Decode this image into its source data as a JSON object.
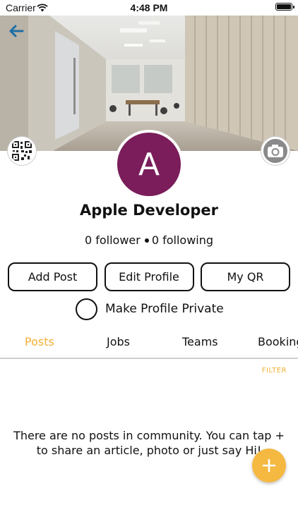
{
  "status_bar": {
    "carrier": "Carrier",
    "time": "4:48 PM"
  },
  "header": {
    "back_icon": "arrow-left-icon",
    "cover_image": "office-hallway-photo"
  },
  "profile": {
    "avatar_initial": "A",
    "avatar_color": "#7a1d5a",
    "name": "Apple Developer",
    "followers": "0 follower",
    "following": "0 following"
  },
  "actions": {
    "add_post": "Add Post",
    "edit_profile": "Edit Profile",
    "my_qr": "My QR"
  },
  "privacy": {
    "label": "Make Profile Private",
    "checked": false
  },
  "tabs": [
    {
      "label": "Posts",
      "active": true
    },
    {
      "label": "Jobs",
      "active": false
    },
    {
      "label": "Teams",
      "active": false
    },
    {
      "label": "Bookings",
      "active": false
    }
  ],
  "filter_label": "FILTER",
  "empty_message": "There are no posts in community. You can tap + to share an article, photo or just say Hi!",
  "colors": {
    "accent": "#f2b035",
    "fab": "#f5b942",
    "back_arrow": "#1d6fa5"
  }
}
